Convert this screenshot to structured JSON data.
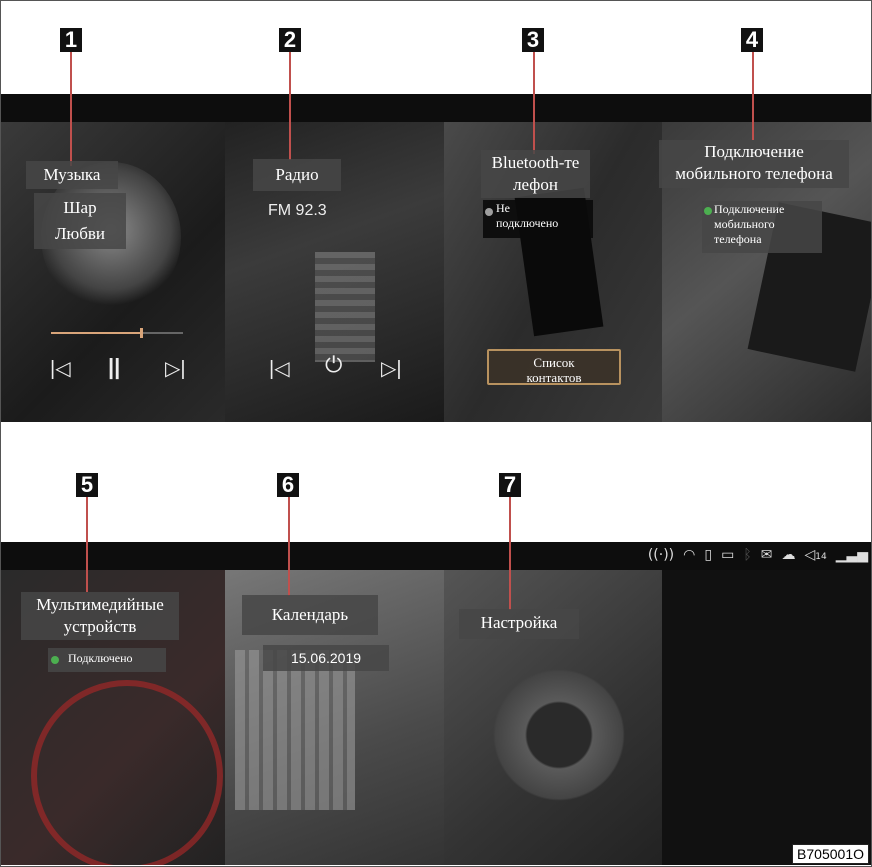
{
  "callouts": [
    "1",
    "2",
    "3",
    "4",
    "5",
    "6",
    "7"
  ],
  "music": {
    "title": "Музыка",
    "track": "Шар\nЛюбви",
    "progress": 0.68
  },
  "radio": {
    "title": "Радио",
    "station": "FM 92.3"
  },
  "bluetooth": {
    "title": "Bluetooth-те\nлефон",
    "status": "Не\nподключено",
    "status_color": "#9e9e9e",
    "contacts_button": "Список\nконтактов"
  },
  "mobile": {
    "title": "Подключение\nмобильного телефона",
    "status": "Подключение\nмобильного\nтелефона",
    "status_color": "#4caf50"
  },
  "media": {
    "title": "Мультимедийные\nустройств",
    "status": "Подключено",
    "status_color": "#4caf50"
  },
  "calendar": {
    "title": "Календарь",
    "date": "15.06.2019"
  },
  "settings": {
    "title": "Настройка"
  },
  "status_bar": {
    "volume": "14",
    "icons": [
      "wireless-icon",
      "wifi-icon",
      "usb-icon",
      "battery-icon",
      "bluetooth-icon",
      "mail-icon",
      "cloud-icon",
      "volume-icon",
      "signal-icon"
    ]
  },
  "figure_code": "B705001O"
}
